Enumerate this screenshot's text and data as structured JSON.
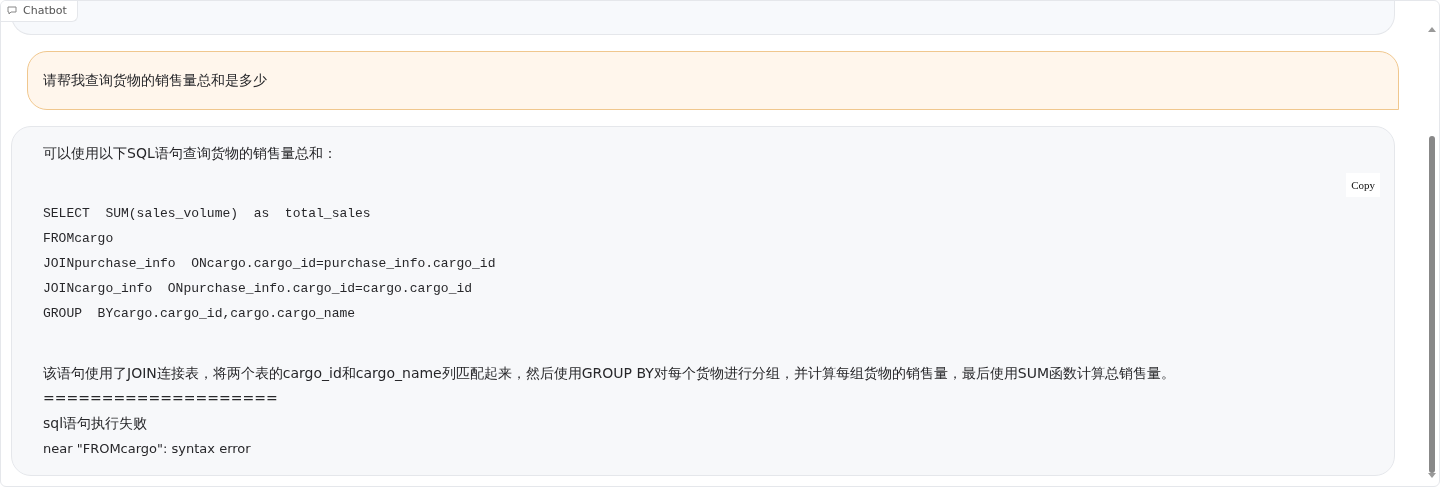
{
  "label": "Chatbot",
  "messages": [
    {
      "kind": "stub"
    },
    {
      "kind": "user",
      "blocks": [
        {
          "kind": "text",
          "text": "请帮我查询货物的销售量总和是多少"
        }
      ]
    },
    {
      "kind": "bot",
      "blocks": [
        {
          "kind": "text",
          "text": "可以使用以下SQL语句查询货物的销售量总和："
        },
        {
          "kind": "code",
          "copy_label": "Copy",
          "lines": [
            "SELECT  SUM(sales_volume)  as  total_sales",
            "FROMcargo",
            "JOINpurchase_info  ONcargo.cargo_id=purchase_info.cargo_id",
            "JOINcargo_info  ONpurchase_info.cargo_id=cargo.cargo_id",
            "GROUP  BYcargo.cargo_id,cargo.cargo_name"
          ]
        },
        {
          "kind": "text",
          "text": "该语句使用了JOIN连接表，将两个表的cargo_id和cargo_name列匹配起来，然后使用GROUP BY对每个货物进行分组，并计算每组货物的销售量，最后使用SUM函数计算总销售量。"
        },
        {
          "kind": "text",
          "text": "===================="
        },
        {
          "kind": "text",
          "text": "sql语句执行失败"
        },
        {
          "kind": "small",
          "text": "near \"FROMcargo\": syntax error"
        }
      ]
    }
  ]
}
